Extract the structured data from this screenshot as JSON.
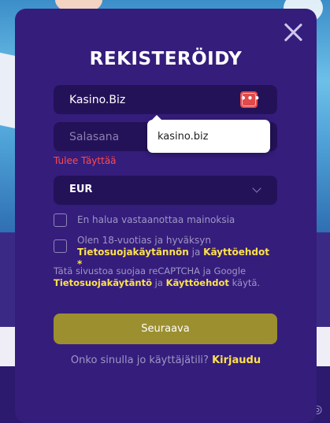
{
  "modal": {
    "title": "REKISTERÖIDY",
    "close_icon": "close-icon"
  },
  "form": {
    "username_value": "Kasino.Biz",
    "password_placeholder": "Salasana",
    "password_error": "Tulee Täyttää",
    "suggestion": "kasino.biz",
    "currency_value": "EUR",
    "checkbox_ads": {
      "label": "En halua vastaanottaa mainoksia",
      "checked": false
    },
    "checkbox_terms": {
      "text_before": "Olen 18-vuotias ja hyväksyn",
      "privacy_link": "Tietosuojakäytännön",
      "conjunction": "ja",
      "terms_link": "Käyttöehdot",
      "required_mark": "*",
      "checked": false
    },
    "recaptcha": {
      "text_before": "Tätä sivustoa suojaa reCAPTCHA ja Google",
      "privacy_link": "Tietosuojakäytäntö",
      "conjunction": "ja",
      "terms_link": "Käyttöehdot",
      "text_after": "käytä."
    },
    "submit_label": "Seuraava",
    "login_prompt": "Onko sinulla jo käyttäjätili?",
    "login_link": "Kirjaudu"
  },
  "colors": {
    "modal_bg": "#351d7c",
    "field_bg": "#241259",
    "accent_yellow": "#ffe14a",
    "error_red": "#ff4a4a",
    "submit_bg": "#9c8f2f"
  }
}
